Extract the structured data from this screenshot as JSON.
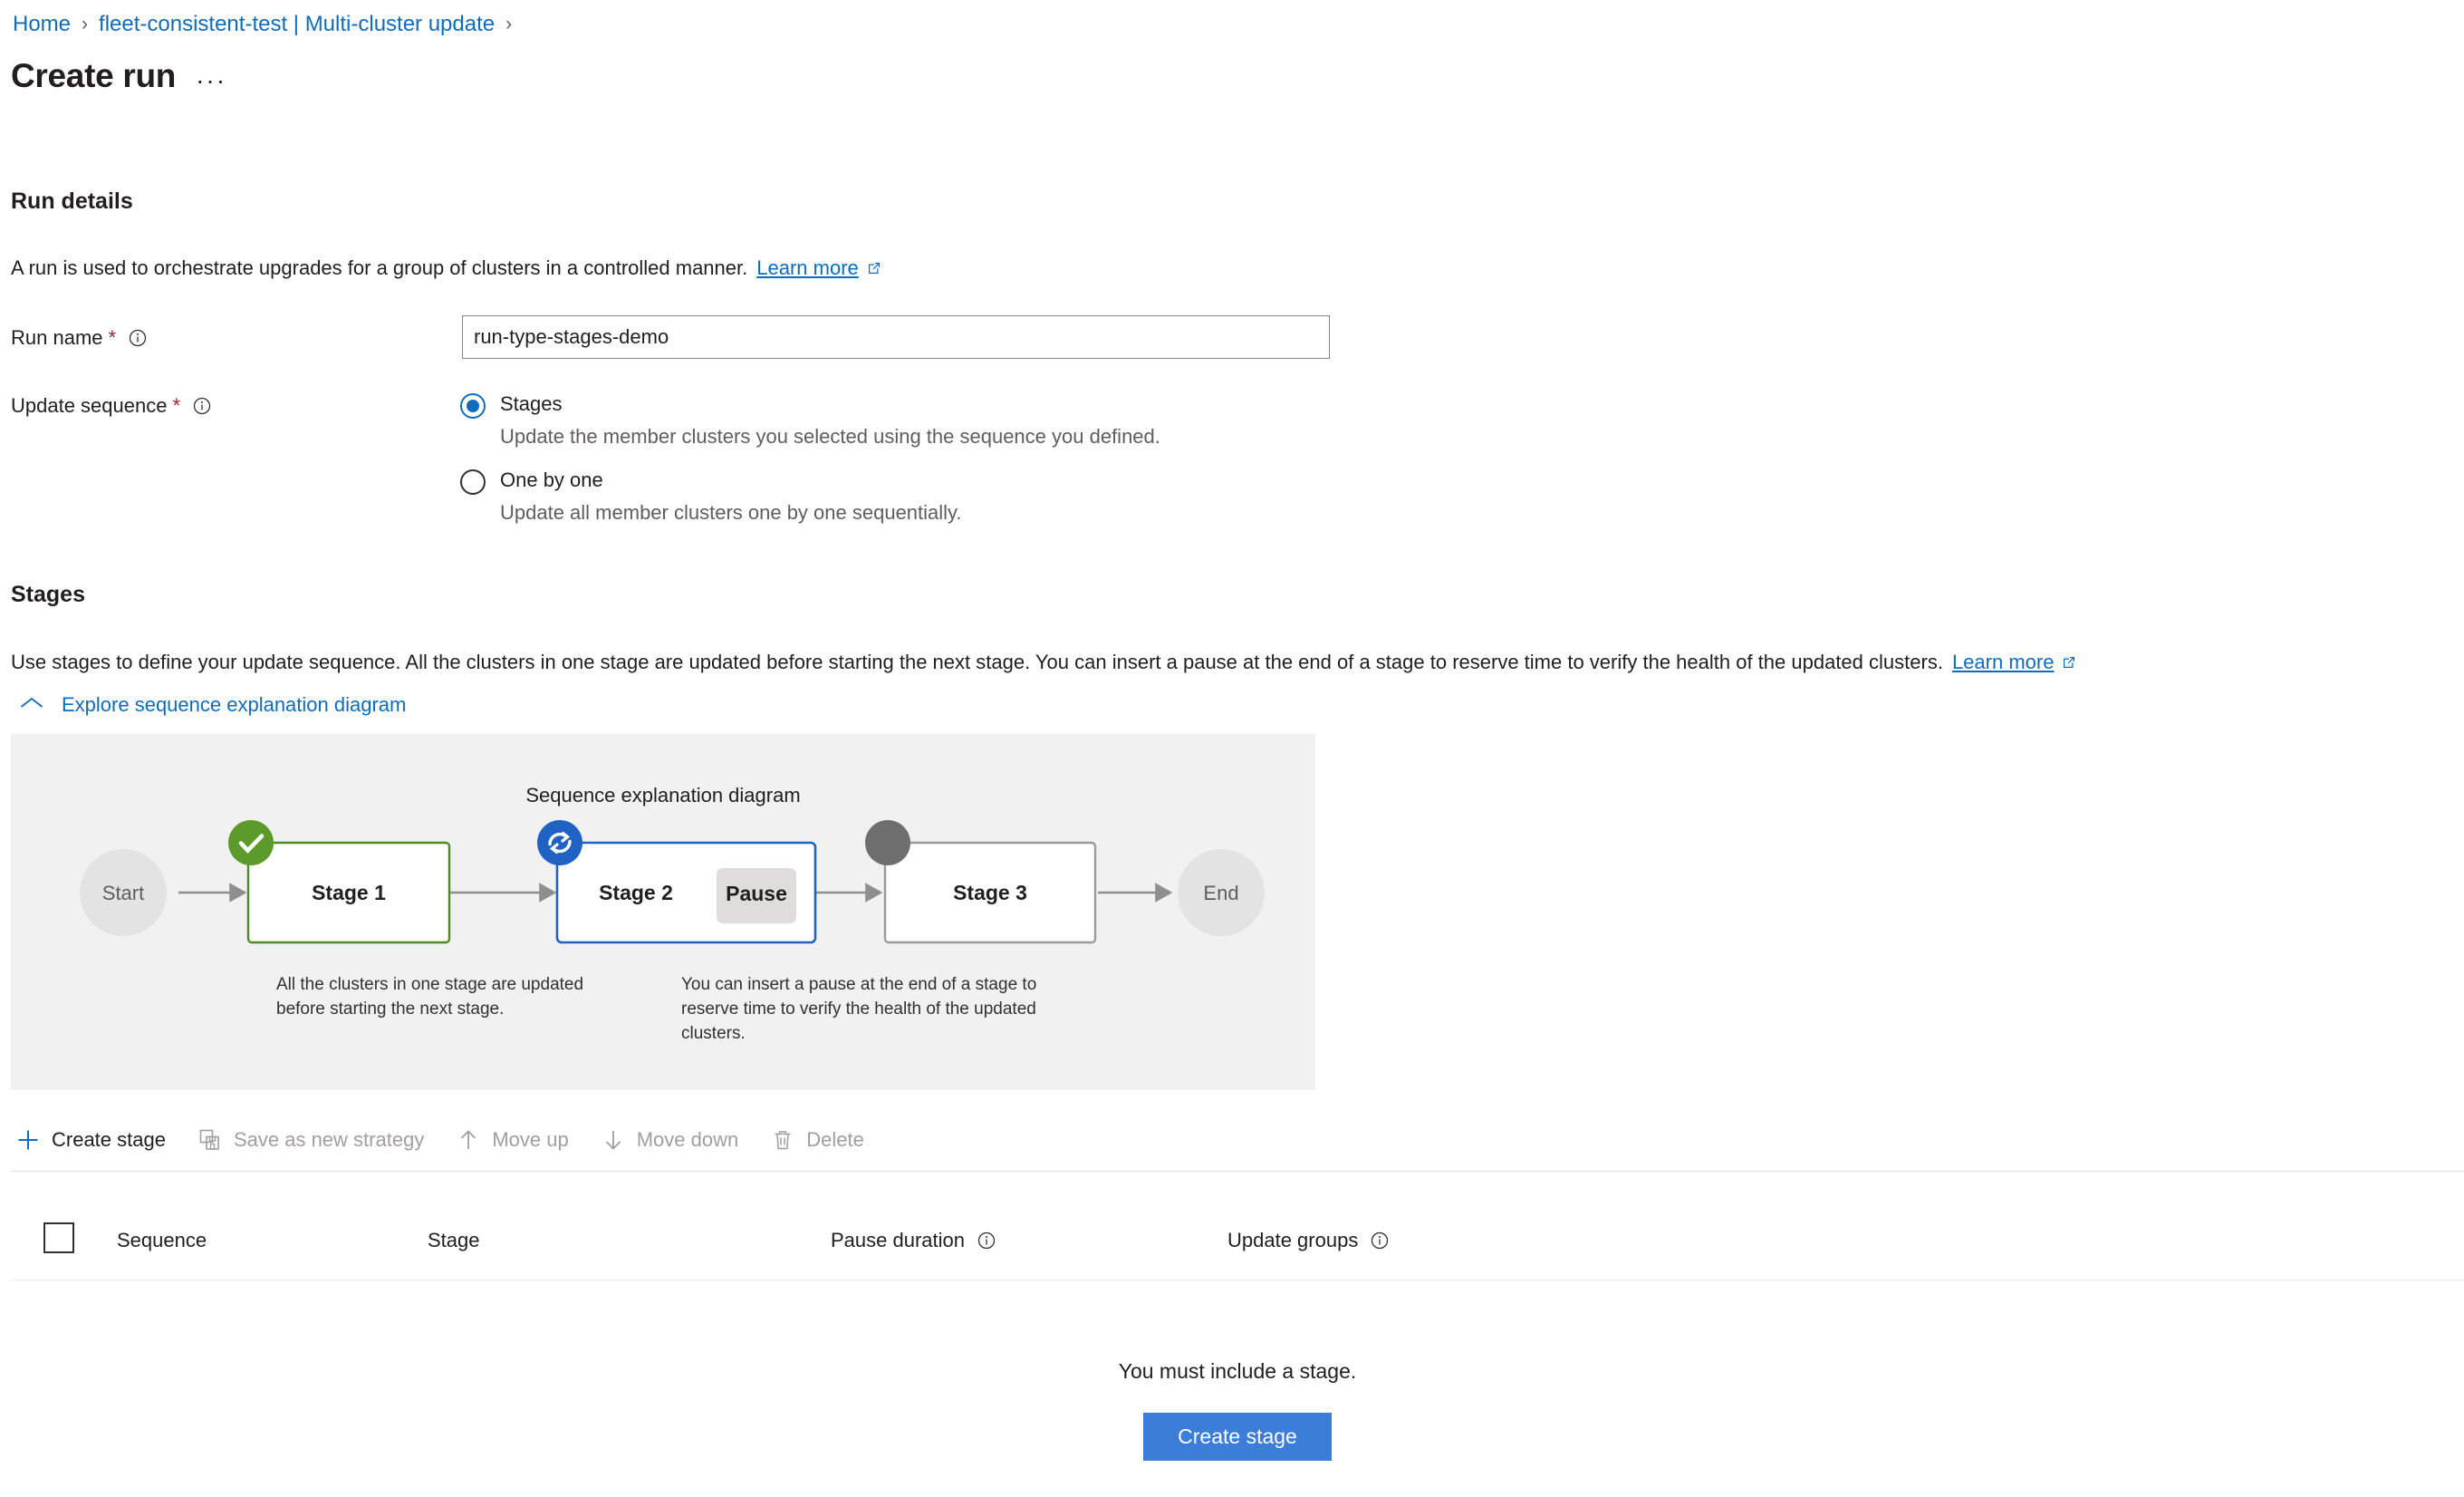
{
  "breadcrumb": {
    "items": [
      {
        "label": "Home"
      },
      {
        "label": "fleet-consistent-test | Multi-cluster update"
      }
    ],
    "separator": "›"
  },
  "header": {
    "title": "Create run",
    "ellipsis": "···"
  },
  "run_details": {
    "section_title": "Run details",
    "description": "A run is used to orchestrate upgrades for a group of clusters in a controlled manner.",
    "learn_more": "Learn more",
    "run_name": {
      "label": "Run name",
      "required_marker": "*",
      "value": "run-type-stages-demo",
      "placeholder": "Enter run name"
    },
    "update_sequence": {
      "label": "Update sequence",
      "required_marker": "*",
      "options": [
        {
          "label": "Stages",
          "description": "Update the member clusters you selected using the sequence you defined.",
          "selected": true
        },
        {
          "label": "One by one",
          "description": "Update all member clusters one by one sequentially.",
          "selected": false
        }
      ]
    }
  },
  "stages": {
    "section_title": "Stages",
    "description": "Use stages to define your update sequence. All the clusters in one stage are updated before starting the next stage. You can insert a pause at the end of a stage to reserve time to verify the health of the updated clusters.",
    "learn_more": "Learn more",
    "explore_toggle": {
      "label": "Explore sequence explanation diagram",
      "expanded": true,
      "icon": "chevron-up-icon"
    },
    "diagram": {
      "caption": "Sequence explanation diagram",
      "start_label": "Start",
      "end_label": "End",
      "nodes": [
        {
          "label": "Stage 1",
          "status": "completed",
          "badge_color": "#5b9a2b",
          "border_color": "#4f8a23",
          "badge_icon": "check-circle-icon",
          "pause": false
        },
        {
          "label": "Stage 2",
          "status": "in-progress",
          "badge_color": "#1f62c4",
          "border_color": "#1f62c4",
          "badge_icon": "sync-circle-icon",
          "pause": true,
          "pause_label": "Pause"
        },
        {
          "label": "Stage 3",
          "status": "not-started",
          "badge_color": "#6e6e6e",
          "border_color": "#9a9a9a",
          "badge_icon": "dot-circle-icon",
          "pause": false
        }
      ],
      "annotations": [
        "All the clusters in one stage are updated before starting the next stage.",
        "You can insert a pause at the end of a stage to reserve time to verify the health of the updated clusters."
      ]
    },
    "toolbar": [
      {
        "label": "Create stage",
        "icon": "plus-icon",
        "disabled": false
      },
      {
        "label": "Save as new strategy",
        "icon": "save-icon",
        "disabled": true
      },
      {
        "label": "Move up",
        "icon": "arrow-up-icon",
        "disabled": true
      },
      {
        "label": "Move down",
        "icon": "arrow-down-icon",
        "disabled": true
      },
      {
        "label": "Delete",
        "icon": "trash-icon",
        "disabled": true
      }
    ],
    "table": {
      "columns": [
        {
          "label": "Sequence",
          "info": false
        },
        {
          "label": "Stage",
          "info": false
        },
        {
          "label": "Pause duration",
          "info": true
        },
        {
          "label": "Update groups",
          "info": true
        }
      ],
      "rows": [],
      "empty_message": "You must include a stage.",
      "empty_action": "Create stage"
    }
  },
  "colors": {
    "link": "#0f6cbd",
    "primary_button": "#3b7dd8",
    "required": "#a4262c",
    "panel_bg": "#f1f1f1",
    "completed": "#5b9a2b",
    "in_progress": "#1f62c4",
    "not_started": "#6e6e6e"
  }
}
